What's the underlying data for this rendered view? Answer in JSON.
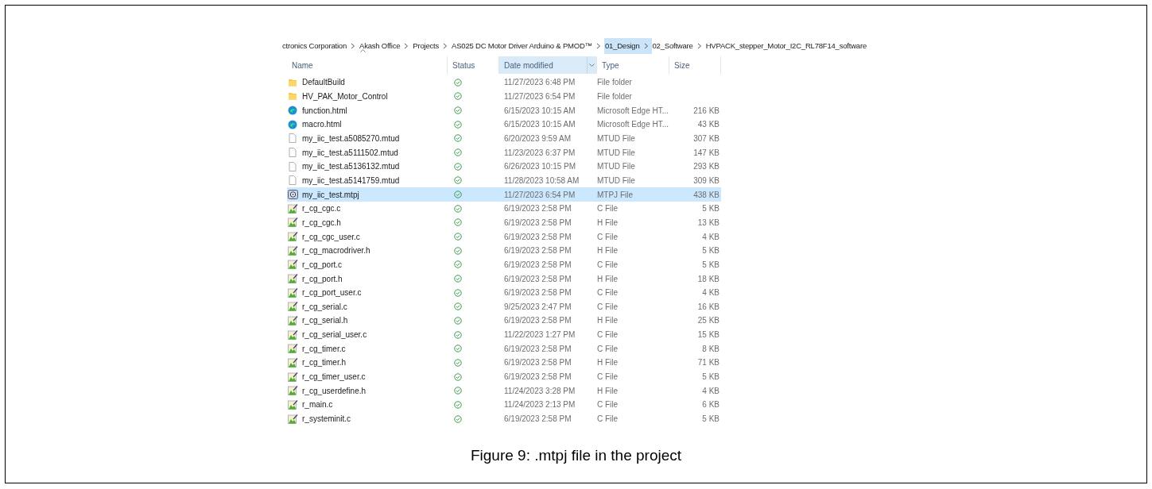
{
  "breadcrumb": [
    {
      "label": "ctronics Corporation",
      "highlighted": false
    },
    {
      "label": "Akash Office",
      "highlighted": false
    },
    {
      "label": "Projects",
      "highlighted": false
    },
    {
      "label": "AS025 DC Motor Driver Arduino & PMOD™",
      "highlighted": false
    },
    {
      "label": "01_Design",
      "highlighted": true
    },
    {
      "label": "02_Software",
      "highlighted": false
    },
    {
      "label": "HVPACK_stepper_Motor_I2C_RL78F14_software",
      "highlighted": false
    }
  ],
  "columns": [
    {
      "label": "Name",
      "sorted": true,
      "highlighted": false
    },
    {
      "label": "Status",
      "sorted": false,
      "highlighted": false
    },
    {
      "label": "Date modified",
      "sorted": false,
      "highlighted": true
    },
    {
      "label": "Type",
      "sorted": false,
      "highlighted": false
    },
    {
      "label": "Size",
      "sorted": false,
      "highlighted": false
    }
  ],
  "files": [
    {
      "kind": "folder",
      "name": "DefaultBuild",
      "date": "11/27/2023 6:48 PM",
      "type": "File folder",
      "selected": false
    },
    {
      "kind": "folder",
      "name": "HV_PAK_Motor_Control",
      "date": "11/27/2023 6:54 PM",
      "type": "File folder",
      "selected": false
    },
    {
      "kind": "web",
      "name": "function.html",
      "date": "6/15/2023 10:15 AM",
      "type": "Microsoft Edge HT...",
      "size": "216 KB",
      "selected": false
    },
    {
      "kind": "web",
      "name": "macro.html",
      "date": "6/15/2023 10:15 AM",
      "type": "Microsoft Edge HT...",
      "size": "43 KB",
      "selected": false
    },
    {
      "kind": "blank",
      "name": "my_iic_test.a5085270.mtud",
      "date": "6/20/2023 9:59 AM",
      "type": "MTUD File",
      "size": "307 KB",
      "selected": false
    },
    {
      "kind": "blank",
      "name": "my_iic_test.a5111502.mtud",
      "date": "11/23/2023 6:37 PM",
      "type": "MTUD File",
      "size": "147 KB",
      "selected": false
    },
    {
      "kind": "blank",
      "name": "my_iic_test.a5136132.mtud",
      "date": "6/26/2023 10:15 PM",
      "type": "MTUD File",
      "size": "293 KB",
      "selected": false
    },
    {
      "kind": "blank",
      "name": "my_iic_test.a5141759.mtud",
      "date": "11/28/2023 10:58 AM",
      "type": "MTUD File",
      "size": "309 KB",
      "selected": false
    },
    {
      "kind": "project",
      "name": "my_iic_test.mtpj",
      "date": "11/27/2023 6:54 PM",
      "type": "MTPJ File",
      "size": "438 KB",
      "selected": true
    },
    {
      "kind": "source",
      "name": "r_cg_cgc.c",
      "date": "6/19/2023 2:58 PM",
      "type": "C File",
      "size": "5 KB",
      "selected": false
    },
    {
      "kind": "source",
      "name": "r_cg_cgc.h",
      "date": "6/19/2023 2:58 PM",
      "type": "H File",
      "size": "13 KB",
      "selected": false
    },
    {
      "kind": "source",
      "name": "r_cg_cgc_user.c",
      "date": "6/19/2023 2:58 PM",
      "type": "C File",
      "size": "4 KB",
      "selected": false
    },
    {
      "kind": "source",
      "name": "r_cg_macrodriver.h",
      "date": "6/19/2023 2:58 PM",
      "type": "H File",
      "size": "5 KB",
      "selected": false
    },
    {
      "kind": "source",
      "name": "r_cg_port.c",
      "date": "6/19/2023 2:58 PM",
      "type": "C File",
      "size": "5 KB",
      "selected": false
    },
    {
      "kind": "source",
      "name": "r_cg_port.h",
      "date": "6/19/2023 2:58 PM",
      "type": "H File",
      "size": "18 KB",
      "selected": false
    },
    {
      "kind": "source",
      "name": "r_cg_port_user.c",
      "date": "6/19/2023 2:58 PM",
      "type": "C File",
      "size": "4 KB",
      "selected": false
    },
    {
      "kind": "source",
      "name": "r_cg_serial.c",
      "date": "9/25/2023 2:47 PM",
      "type": "C File",
      "size": "16 KB",
      "selected": false
    },
    {
      "kind": "source",
      "name": "r_cg_serial.h",
      "date": "6/19/2023 2:58 PM",
      "type": "H File",
      "size": "25 KB",
      "selected": false
    },
    {
      "kind": "source",
      "name": "r_cg_serial_user.c",
      "date": "11/22/2023 1:27 PM",
      "type": "C File",
      "size": "15 KB",
      "selected": false
    },
    {
      "kind": "source",
      "name": "r_cg_timer.c",
      "date": "6/19/2023 2:58 PM",
      "type": "C File",
      "size": "8 KB",
      "selected": false
    },
    {
      "kind": "source",
      "name": "r_cg_timer.h",
      "date": "6/19/2023 2:58 PM",
      "type": "H File",
      "size": "71 KB",
      "selected": false
    },
    {
      "kind": "source",
      "name": "r_cg_timer_user.c",
      "date": "6/19/2023 2:58 PM",
      "type": "C File",
      "size": "5 KB",
      "selected": false
    },
    {
      "kind": "source",
      "name": "r_cg_userdefine.h",
      "date": "11/24/2023 3:28 PM",
      "type": "H File",
      "size": "4 KB",
      "selected": false
    },
    {
      "kind": "source",
      "name": "r_main.c",
      "date": "11/24/2023 2:13 PM",
      "type": "C File",
      "size": "6 KB",
      "selected": false
    },
    {
      "kind": "source",
      "name": "r_systeminit.c",
      "date": "6/19/2023 2:58 PM",
      "type": "C File",
      "size": "5 KB",
      "selected": false
    }
  ],
  "caption": "Figure 9: .mtpj file in the project"
}
